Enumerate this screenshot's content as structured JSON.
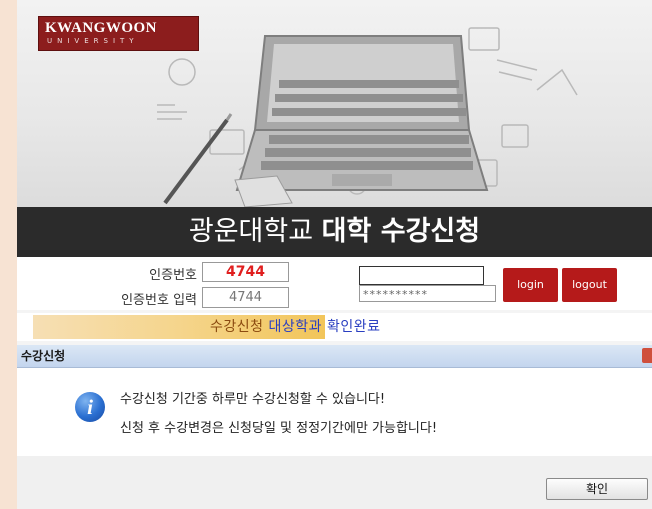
{
  "logo": {
    "name": "KWANGWOON",
    "sub": "UNIVERSITY"
  },
  "title": {
    "normal": "광운대학교 ",
    "bold": "대학 수강신청"
  },
  "login": {
    "code_label": "인증번호",
    "code_value": "4744",
    "code_input_label": "인증번호 입력",
    "code_input_value": "4744",
    "id_value": "",
    "password_mask": "**********",
    "login_button": "login",
    "logout_button": "logout"
  },
  "banner": {
    "part1": "수강신청",
    "part2": " 대상학과 확인완료"
  },
  "dialog": {
    "title": "수강신청",
    "line1": "수강신청 기간중 하루만 수강신청할 수 있습니다!",
    "line2": "신청 후 수강변경은 신청당일 및 정정기간에만 가능합니다!",
    "ok_button": "확인",
    "icon": "info-icon"
  },
  "colors": {
    "brand": "#8c1d1d",
    "accent_red": "#b51a1a",
    "code_red": "#e01f1f",
    "band": "#2b2b2b"
  }
}
